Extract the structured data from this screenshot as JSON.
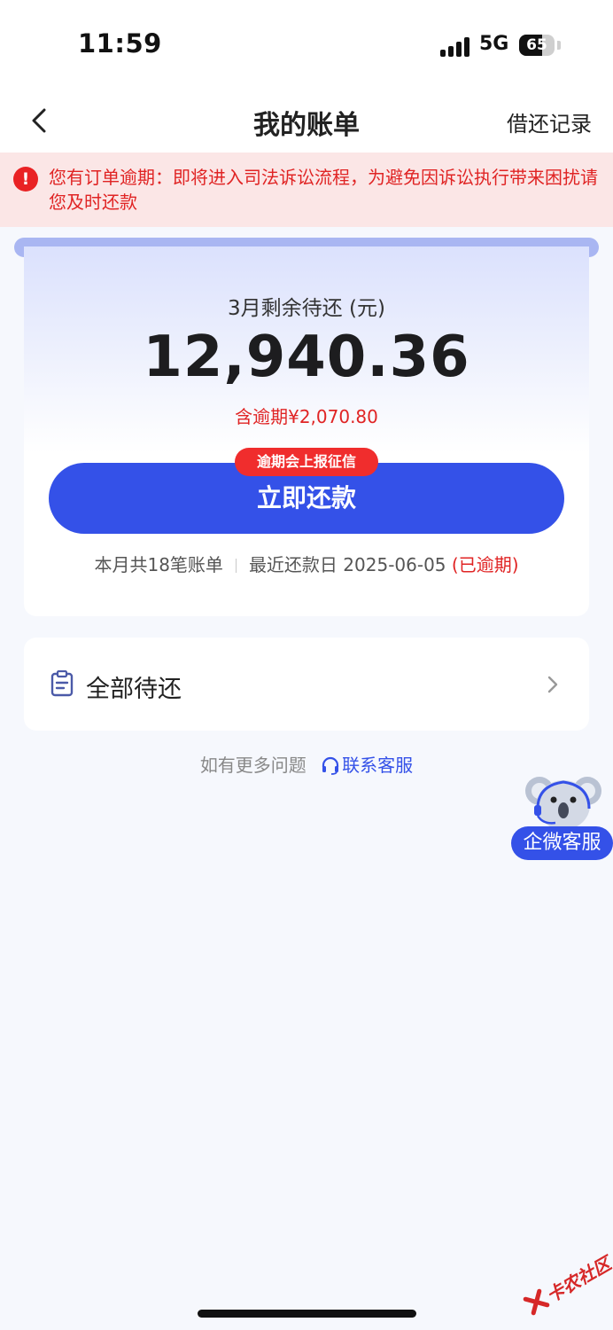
{
  "status_bar": {
    "time": "11:59",
    "network": "5G",
    "battery": "65",
    "battery_level": 0.65
  },
  "nav": {
    "back_icon": "chevron-left-icon",
    "title": "我的账单",
    "right_action": "借还记录"
  },
  "alert": {
    "icon": "exclamation-circle-icon",
    "text": "您有订单逾期：即将进入司法诉讼流程，为避免因诉讼执行带来困扰请您及时还款",
    "color": "#e02424"
  },
  "bill": {
    "label": "3月剩余待还 (元)",
    "amount": "12,940.36",
    "overdue_amount": "含逾期¥2,070.80",
    "credit_badge": "逾期会上报征信",
    "repay_button": "立即还款",
    "bill_count": "本月共18笔账单",
    "due_date": "最近还款日 2025-06-05",
    "overdue_tag": "(已逾期)"
  },
  "pending": {
    "icon": "document-icon",
    "label": "全部待还",
    "chevron": "chevron-right-icon"
  },
  "help": {
    "prefix": "如有更多问题",
    "icon": "headset-icon",
    "link": "联系客服"
  },
  "float_service": {
    "icon": "koala-agent-icon",
    "label": "企微客服"
  },
  "watermark": {
    "text": "卡农社区"
  },
  "colors": {
    "accent": "#3451e8",
    "danger": "#e02424",
    "background": "#f6f8fd"
  }
}
